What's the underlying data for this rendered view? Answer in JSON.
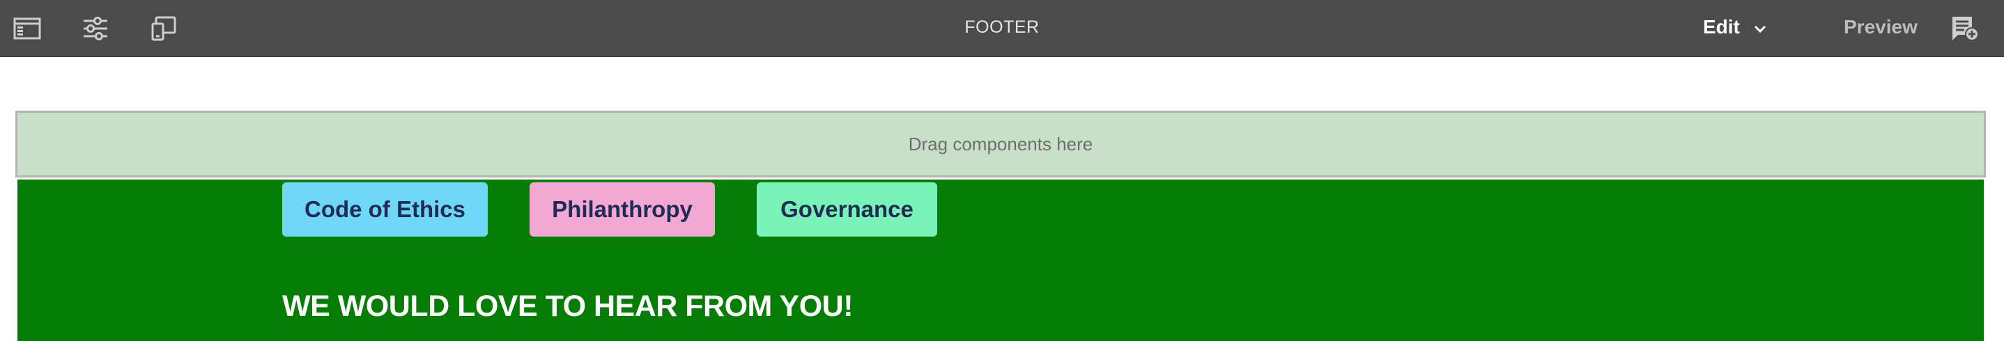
{
  "toolbar": {
    "icons": {
      "side_panel": "side-panel-icon",
      "properties": "sliders-icon",
      "emulator": "device-emulator-icon",
      "annotations": "annotations-icon"
    },
    "title": "FOOTER",
    "mode_label": "Edit",
    "preview_label": "Preview"
  },
  "page": {
    "dropzone_text": "Drag components here",
    "links": [
      {
        "label": "Code of Ethics",
        "color": "#6fd7f6"
      },
      {
        "label": "Philanthropy",
        "color": "#f3a8d3"
      },
      {
        "label": "Governance",
        "color": "#79f2b8"
      }
    ],
    "heading": "WE WOULD LOVE TO HEAR FROM YOU!",
    "colors": {
      "toolbar_bg": "#4b4b4b",
      "dropzone_bg": "#c8e0c8",
      "footer_bg": "#067e06"
    }
  }
}
